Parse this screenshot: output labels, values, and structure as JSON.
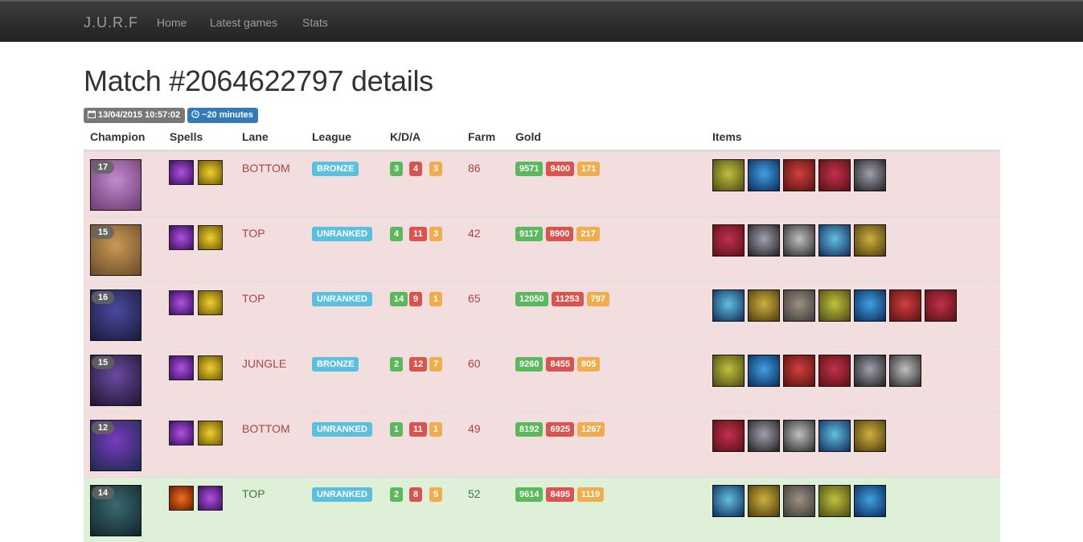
{
  "navbar": {
    "brand": "J.U.R.F",
    "links": [
      "Home",
      "Latest games",
      "Stats"
    ]
  },
  "page": {
    "title": "Match #2064622797 details",
    "date": "13/04/2015 10:57:02",
    "duration": "~20 minutes"
  },
  "table": {
    "headers": [
      "Champion",
      "Spells",
      "Lane",
      "League",
      "K/D/A",
      "Farm",
      "Gold",
      "Items"
    ],
    "rows": [
      {
        "result": "loss",
        "level": "17",
        "lane": "BOTTOM",
        "league": "BRONZE",
        "k": "3",
        "d": "4",
        "a": "3",
        "farm": "86",
        "gold_total": "9571",
        "gold_spent": "9400",
        "gold_left": "171",
        "champion_icon": "teemo-like-purple-champion-portrait",
        "spells": [
          "ghost-spell-icon",
          "flash-spell-icon"
        ],
        "item_count": 5
      },
      {
        "result": "loss",
        "level": "15",
        "lane": "TOP",
        "league": "UNRANKED",
        "k": "4",
        "d": "11",
        "a": "3",
        "farm": "42",
        "gold_total": "9117",
        "gold_spent": "8900",
        "gold_left": "217",
        "champion_icon": "teemo-champion-portrait",
        "spells": [
          "ghost-spell-icon",
          "flash-spell-icon"
        ],
        "item_count": 5
      },
      {
        "result": "loss",
        "level": "16",
        "lane": "TOP",
        "league": "UNRANKED",
        "k": "14",
        "d": "9",
        "a": "1",
        "farm": "65",
        "gold_total": "12050",
        "gold_spent": "11253",
        "gold_left": "797",
        "champion_icon": "kassadin-champion-portrait",
        "spells": [
          "ghost-spell-icon",
          "flash-spell-icon"
        ],
        "item_count": 7
      },
      {
        "result": "loss",
        "level": "15",
        "lane": "JUNGLE",
        "league": "BRONZE",
        "k": "2",
        "d": "12",
        "a": "7",
        "farm": "60",
        "gold_total": "9260",
        "gold_spent": "8455",
        "gold_left": "805",
        "champion_icon": "veigar-champion-portrait",
        "spells": [
          "ghost-spell-icon",
          "flash-spell-icon"
        ],
        "item_count": 6
      },
      {
        "result": "loss",
        "level": "12",
        "lane": "BOTTOM",
        "league": "UNRANKED",
        "k": "1",
        "d": "11",
        "a": "1",
        "farm": "49",
        "gold_total": "8192",
        "gold_spent": "6925",
        "gold_left": "1267",
        "champion_icon": "kha-zix-champion-portrait",
        "spells": [
          "ghost-spell-icon",
          "flash-spell-icon"
        ],
        "item_count": 5
      },
      {
        "result": "win",
        "level": "14",
        "lane": "TOP",
        "league": "UNRANKED",
        "k": "2",
        "d": "8",
        "a": "5",
        "farm": "52",
        "gold_total": "9614",
        "gold_spent": "8495",
        "gold_left": "1119",
        "champion_icon": "dark-champion-portrait",
        "spells": [
          "ignite-spell-icon",
          "ghost-spell-icon"
        ],
        "item_count": 5
      }
    ]
  },
  "colors": {
    "loss_row": "#f2dede",
    "win_row": "#dff0d8",
    "label_success": "#5cb85c",
    "label_danger": "#d9534f",
    "label_warning": "#f0ad4e",
    "label_info": "#5bc0de",
    "label_primary": "#337ab7"
  }
}
